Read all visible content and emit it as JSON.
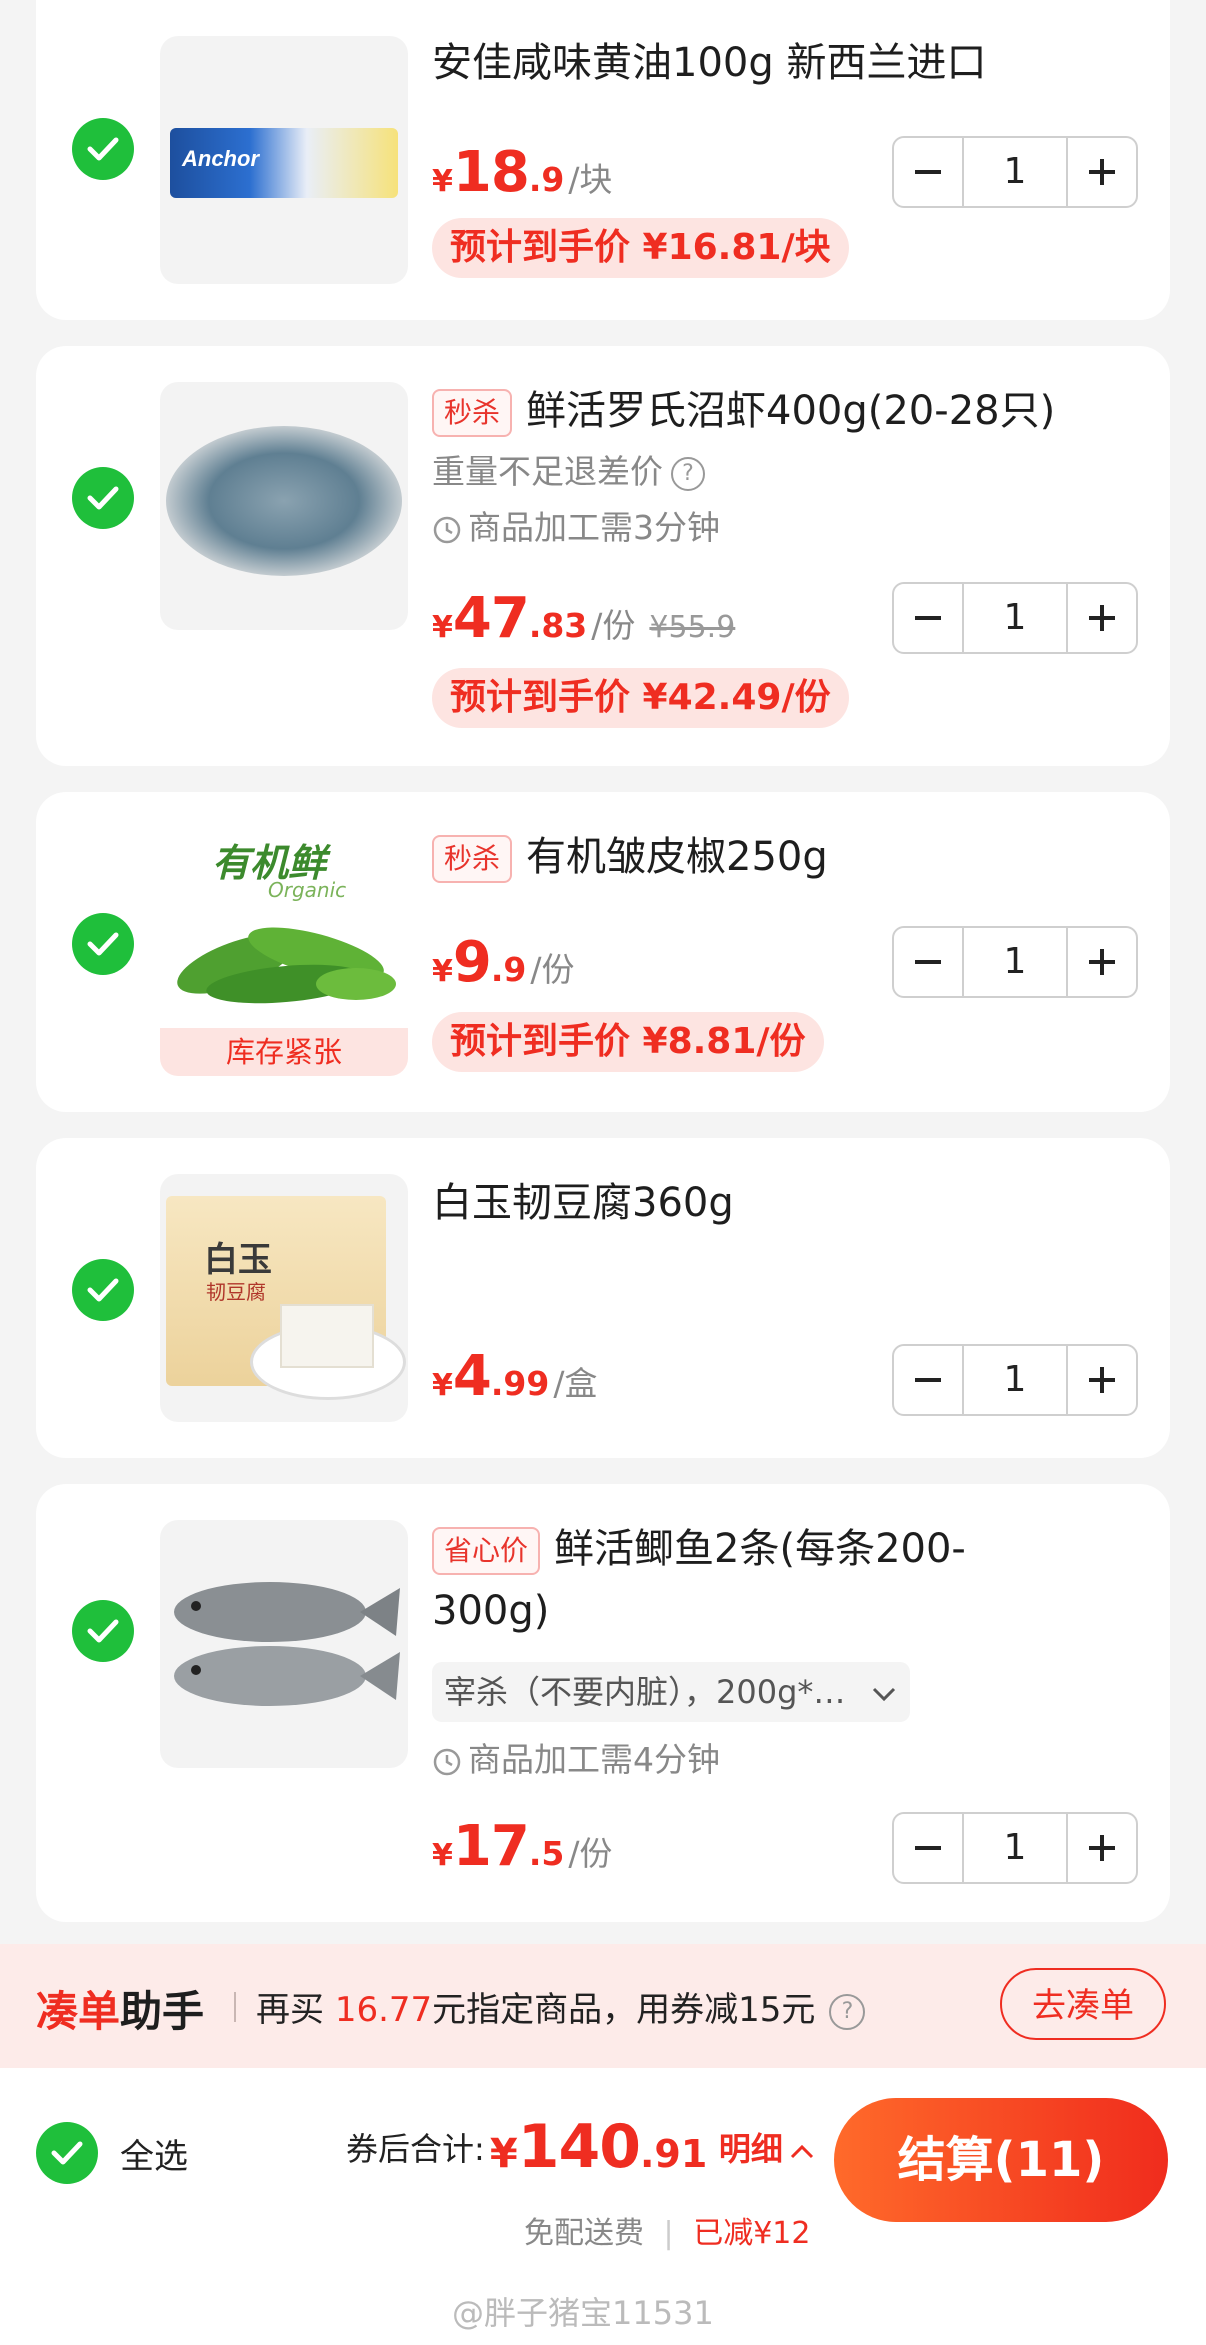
{
  "items": [
    {
      "title": "安佳咸味黄油100g 新西兰进口",
      "price": {
        "currency": "¥",
        "integer": "18",
        "decimal": ".9",
        "unit": "/块"
      },
      "estimate": "预计到手价 ¥16.81/块",
      "quantity": "1",
      "image_label": "Anchor"
    },
    {
      "tag": "秒杀",
      "title": "鲜活罗氏沼虾400g(20-28只)",
      "notice": "重量不足退差价",
      "processing": "商品加工需3分钟",
      "price": {
        "currency": "¥",
        "integer": "47",
        "decimal": ".83",
        "unit": "/份",
        "original": "¥55.9"
      },
      "estimate": "预计到手价 ¥42.49/份",
      "quantity": "1"
    },
    {
      "tag": "秒杀",
      "title": "有机皱皮椒250g",
      "price": {
        "currency": "¥",
        "integer": "9",
        "decimal": ".9",
        "unit": "/份"
      },
      "estimate": "预计到手价 ¥8.81/份",
      "quantity": "1",
      "image_label": "有机鲜",
      "image_sublabel": "Organic",
      "stock_badge": "库存紧张"
    },
    {
      "title": "白玉韧豆腐360g",
      "price": {
        "currency": "¥",
        "integer": "4",
        "decimal": ".99",
        "unit": "/盒"
      },
      "quantity": "1",
      "image_label": "白玉",
      "image_sublabel": "韧豆腐"
    },
    {
      "tag": "省心价",
      "title_line1": "鲜活鲫鱼2条(每条200-",
      "title_line2": "300g)",
      "variant": "宰杀（不要内脏），200g*…",
      "processing": "商品加工需4分钟",
      "price": {
        "currency": "¥",
        "integer": "17",
        "decimal": ".5",
        "unit": "/份"
      },
      "quantity": "1"
    }
  ],
  "helper": {
    "title_red": "凑单",
    "title_dark": "助手",
    "text_prefix": "再买",
    "amount": "16.77",
    "text_suffix": "元指定商品，用券减15元",
    "button": "去凑单"
  },
  "footer": {
    "select_all": "全选",
    "total_label": "券后合计:",
    "total_currency": "¥",
    "total_integer": "140",
    "total_decimal": ".91",
    "detail": "明细",
    "shipping": "免配送费",
    "discount": "已减¥12",
    "checkout": "结算(11)"
  },
  "watermark": "@胖子猪宝11531",
  "colors": {
    "accent": "#ef2d21",
    "check": "#1fbf3b",
    "estimate_bg": "#fde4e1"
  }
}
